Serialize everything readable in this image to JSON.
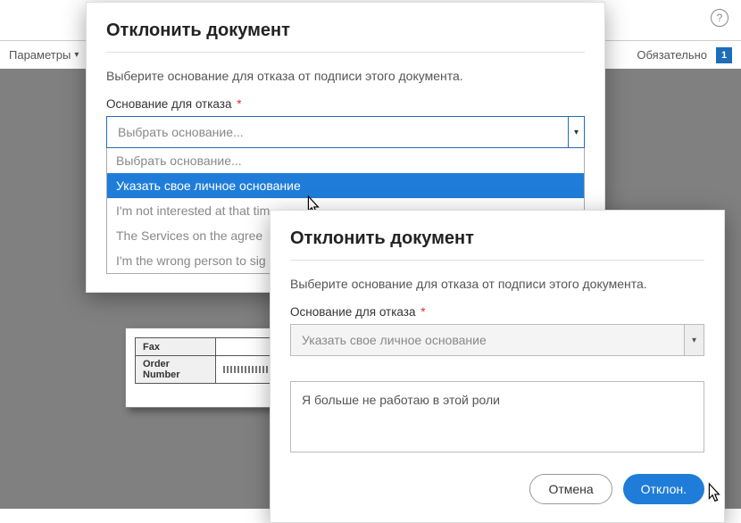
{
  "header": {
    "help_glyph": "?",
    "params_label": "Параметры",
    "required_label": "Обязательно",
    "badge_count": "1"
  },
  "background_doc": {
    "row1": "Fax",
    "row2": "Order Number"
  },
  "modal1": {
    "title": "Отклонить документ",
    "instruction": "Выберите основание для отказа от подписи этого документа.",
    "field_label": "Основание для отказа",
    "required_mark": "*",
    "placeholder": "Выбрать основание...",
    "options": [
      "Выбрать основание...",
      "Указать свое личное основание",
      "I'm not interested at that tim",
      "The Services on the agree",
      "I'm the wrong person to sig"
    ]
  },
  "modal2": {
    "title": "Отклонить документ",
    "instruction": "Выберите основание для отказа от подписи этого документа.",
    "field_label": "Основание для отказа",
    "required_mark": "*",
    "selected_option": "Указать свое личное основание",
    "custom_reason": "Я больше не работаю в этой роли",
    "cancel_label": "Отмена",
    "submit_label": "Отклон."
  }
}
